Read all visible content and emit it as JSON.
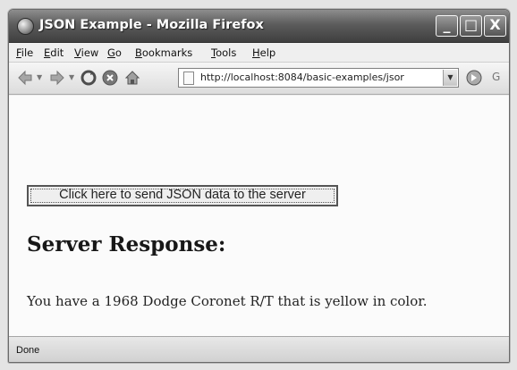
{
  "window": {
    "title": "JSON Example - Mozilla Firefox",
    "controls": {
      "minimize": "_",
      "maximize": "□",
      "close": "X"
    }
  },
  "menu": {
    "items": [
      "File",
      "Edit",
      "View",
      "Go",
      "Bookmarks",
      "Tools",
      "Help"
    ]
  },
  "toolbar": {
    "url": "http://localhost:8084/basic-examples/jsor",
    "icons": [
      "back-icon",
      "forward-icon",
      "reload-icon",
      "stop-icon",
      "home-icon",
      "page-icon",
      "go-icon"
    ]
  },
  "page": {
    "button_label": "Click here to send JSON data to the server",
    "heading": "Server Response:",
    "response_text": "You have a 1968 Dodge Coronet R/T that is yellow in color."
  },
  "status": {
    "text": "Done"
  }
}
